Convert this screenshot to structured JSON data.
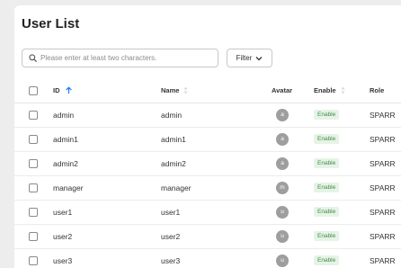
{
  "page": {
    "title": "User List"
  },
  "search": {
    "placeholder": "Please enter at least two characters."
  },
  "filter": {
    "label": "Filter"
  },
  "table": {
    "columns": {
      "id": "ID",
      "name": "Name",
      "avatar": "Avatar",
      "enable": "Enable",
      "role": "Role"
    },
    "rows": [
      {
        "id": "admin",
        "name": "admin",
        "avatar": "a",
        "enable": "Enable",
        "role": "SPARR"
      },
      {
        "id": "admin1",
        "name": "admin1",
        "avatar": "a",
        "enable": "Enable",
        "role": "SPARR"
      },
      {
        "id": "admin2",
        "name": "admin2",
        "avatar": "a",
        "enable": "Enable",
        "role": "SPARR"
      },
      {
        "id": "manager",
        "name": "manager",
        "avatar": "m",
        "enable": "Enable",
        "role": "SPARR"
      },
      {
        "id": "user1",
        "name": "user1",
        "avatar": "u",
        "enable": "Enable",
        "role": "SPARR"
      },
      {
        "id": "user2",
        "name": "user2",
        "avatar": "u",
        "enable": "Enable",
        "role": "SPARR"
      },
      {
        "id": "user3",
        "name": "user3",
        "avatar": "u",
        "enable": "Enable",
        "role": "SPARR"
      }
    ]
  },
  "colors": {
    "accent": "#1677ff",
    "enable_bg": "#e6f3e6",
    "enable_text": "#3e8e47",
    "avatar_bg": "#9e9e9e"
  },
  "icons": {
    "search": "search-icon",
    "filter": "chevron-down-icon",
    "sort_asc": "arrow-up-icon",
    "sort": "sort-icon"
  }
}
